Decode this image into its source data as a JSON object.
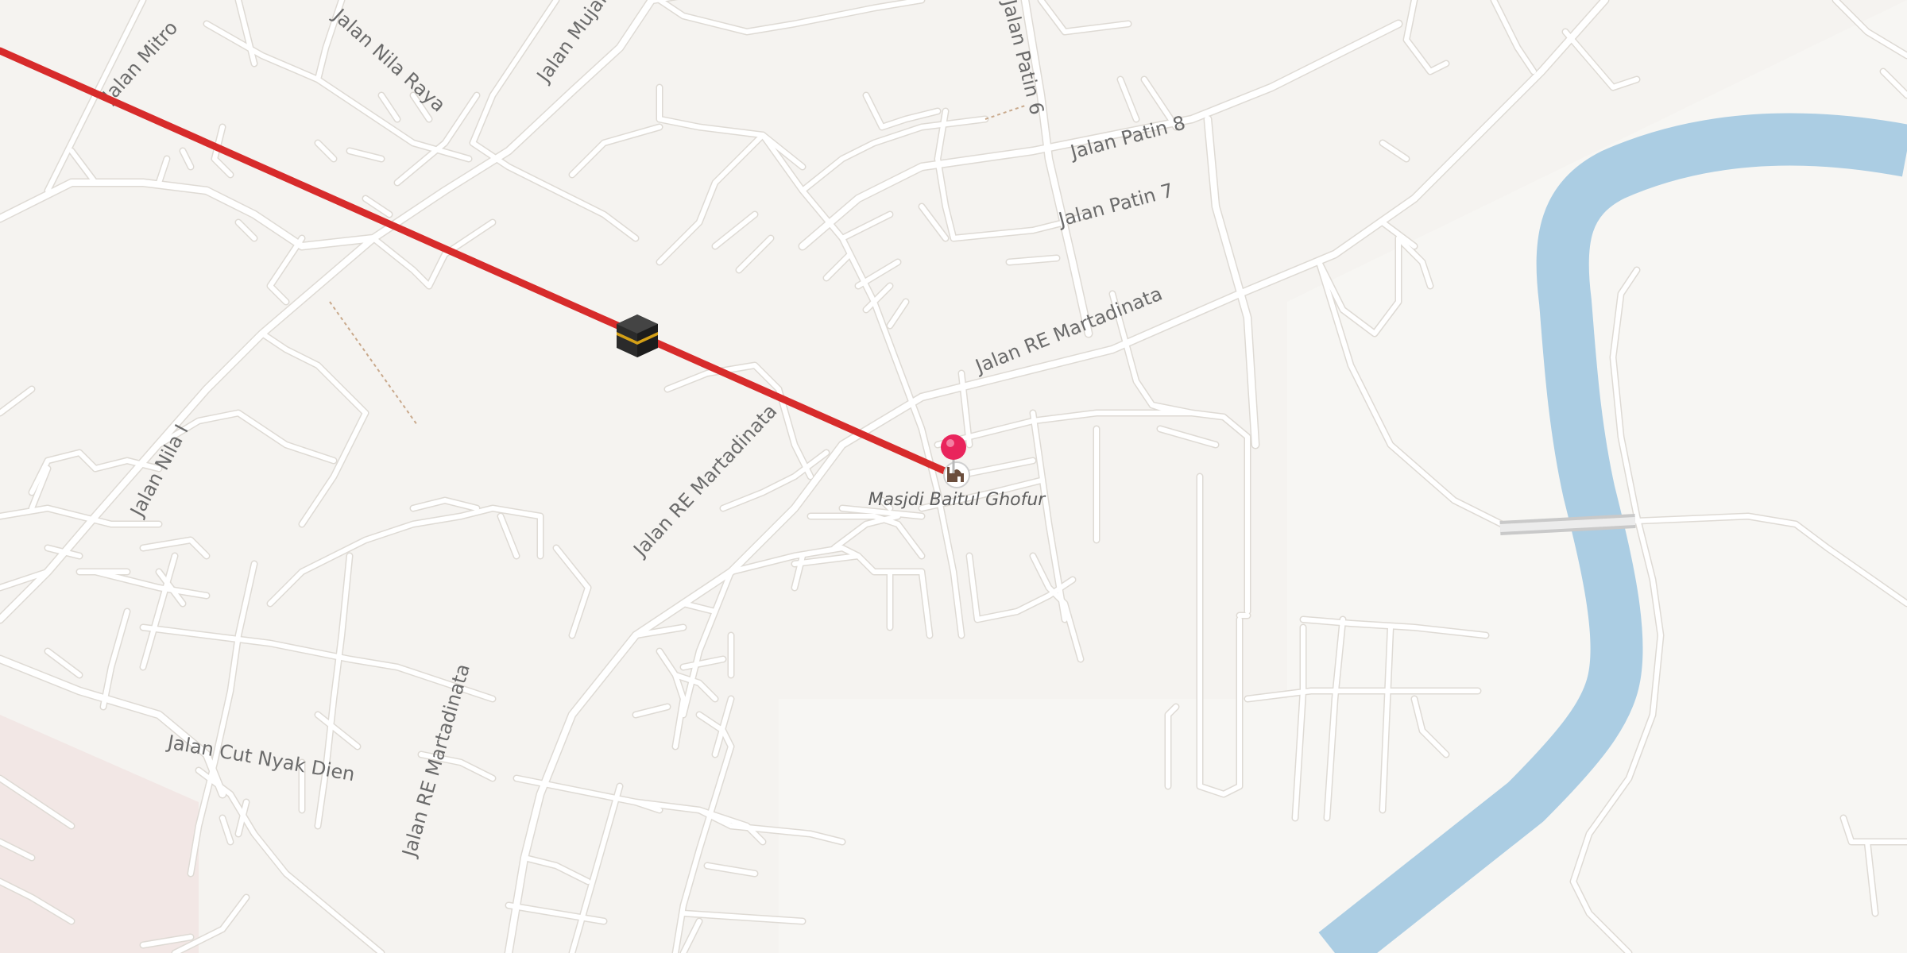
{
  "map": {
    "poi": {
      "name": "Masjdi Baitul Ghofur",
      "icon": "mosque-icon",
      "marker_icon": "pin-marker-icon"
    },
    "qibla_icon": "kaaba-icon",
    "direction_line_color": "#d72b2b",
    "pin_color": "#e9245c",
    "river_color": "#abcde3",
    "land_color": "#f5f3f0",
    "street_labels": [
      "Jalan Mitro",
      "Jalan Nila Raya",
      "Jalan Mujair",
      "Jalan Patin 6",
      "Jalan Patin 8",
      "Jalan Patin 7",
      "Jalan RE Martadinata",
      "Jalan RE Martadinata",
      "Jalan Nila I",
      "Jalan RE Martadinata",
      "Jalan Cut Nyak Dien"
    ]
  }
}
